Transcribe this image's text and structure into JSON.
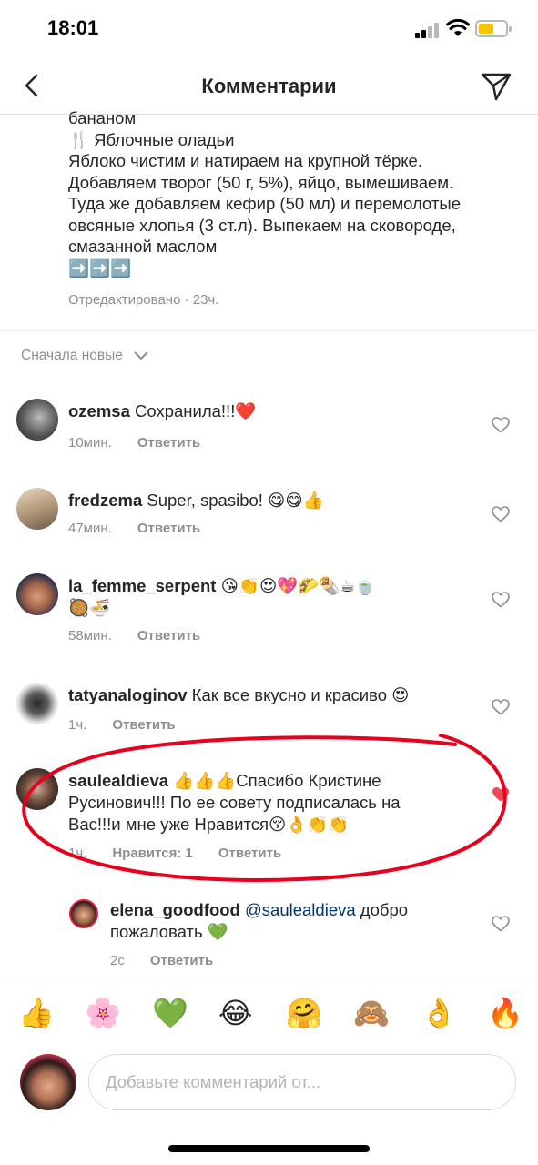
{
  "status_bar": {
    "time": "18:01"
  },
  "header": {
    "title": "Комментарии"
  },
  "caption": {
    "lines": [
      "бананом",
      "🍴 Яблочные оладьи",
      "Яблоко чистим и натираем на крупной тёрке.",
      "Добавляем творог (50 г, 5%), яйцо, вымешиваем.",
      "Туда же добавляем кефир (50 мл) и перемолотые",
      "овсяные хлопья (3 ст.л). Выпекаем на сковороде,",
      "смазанной маслом",
      "➡️➡️➡️"
    ],
    "meta": "Отредактировано · 23ч."
  },
  "sort": {
    "label": "Сначала новые"
  },
  "comments": [
    {
      "user": "ozemsa",
      "text": "Сохранила!!!❤️",
      "time": "10мин.",
      "reply": "Ответить"
    },
    {
      "user": "fredzema",
      "text": "Super, spasibo! 😋😋👍",
      "time": "47мин.",
      "reply": "Ответить"
    },
    {
      "user": "la_femme_serpent",
      "text": "😘👏😍💖🌮🌯☕🍵",
      "text2": "🥘🍜",
      "time": "58мин.",
      "reply": "Ответить"
    },
    {
      "user": "tatyanaloginov",
      "text": "Как все вкусно и красиво 😍",
      "time": "1ч.",
      "reply": "Ответить"
    },
    {
      "user": "saulealdieva",
      "text": "👍👍👍Спасибо Кристине",
      "text2": "Русинович!!! По ее совету подписалась на",
      "text3": "Вас!!!и мне уже Нравится😚👌👏👏",
      "time": "1ч.",
      "likes": "Нравится: 1",
      "reply": "Ответить"
    },
    {
      "user": "elena_goodfood",
      "mention": "@saulealdieva",
      "text": "добро",
      "text2": "пожаловать 💚",
      "time": "2c",
      "reply": "Ответить"
    }
  ],
  "emoji_bar": [
    "👍",
    "🌸",
    "💚",
    "😂",
    "🤗",
    "🙈",
    "👌",
    "🔥"
  ],
  "composer": {
    "placeholder": "Добавьте комментарий от..."
  }
}
